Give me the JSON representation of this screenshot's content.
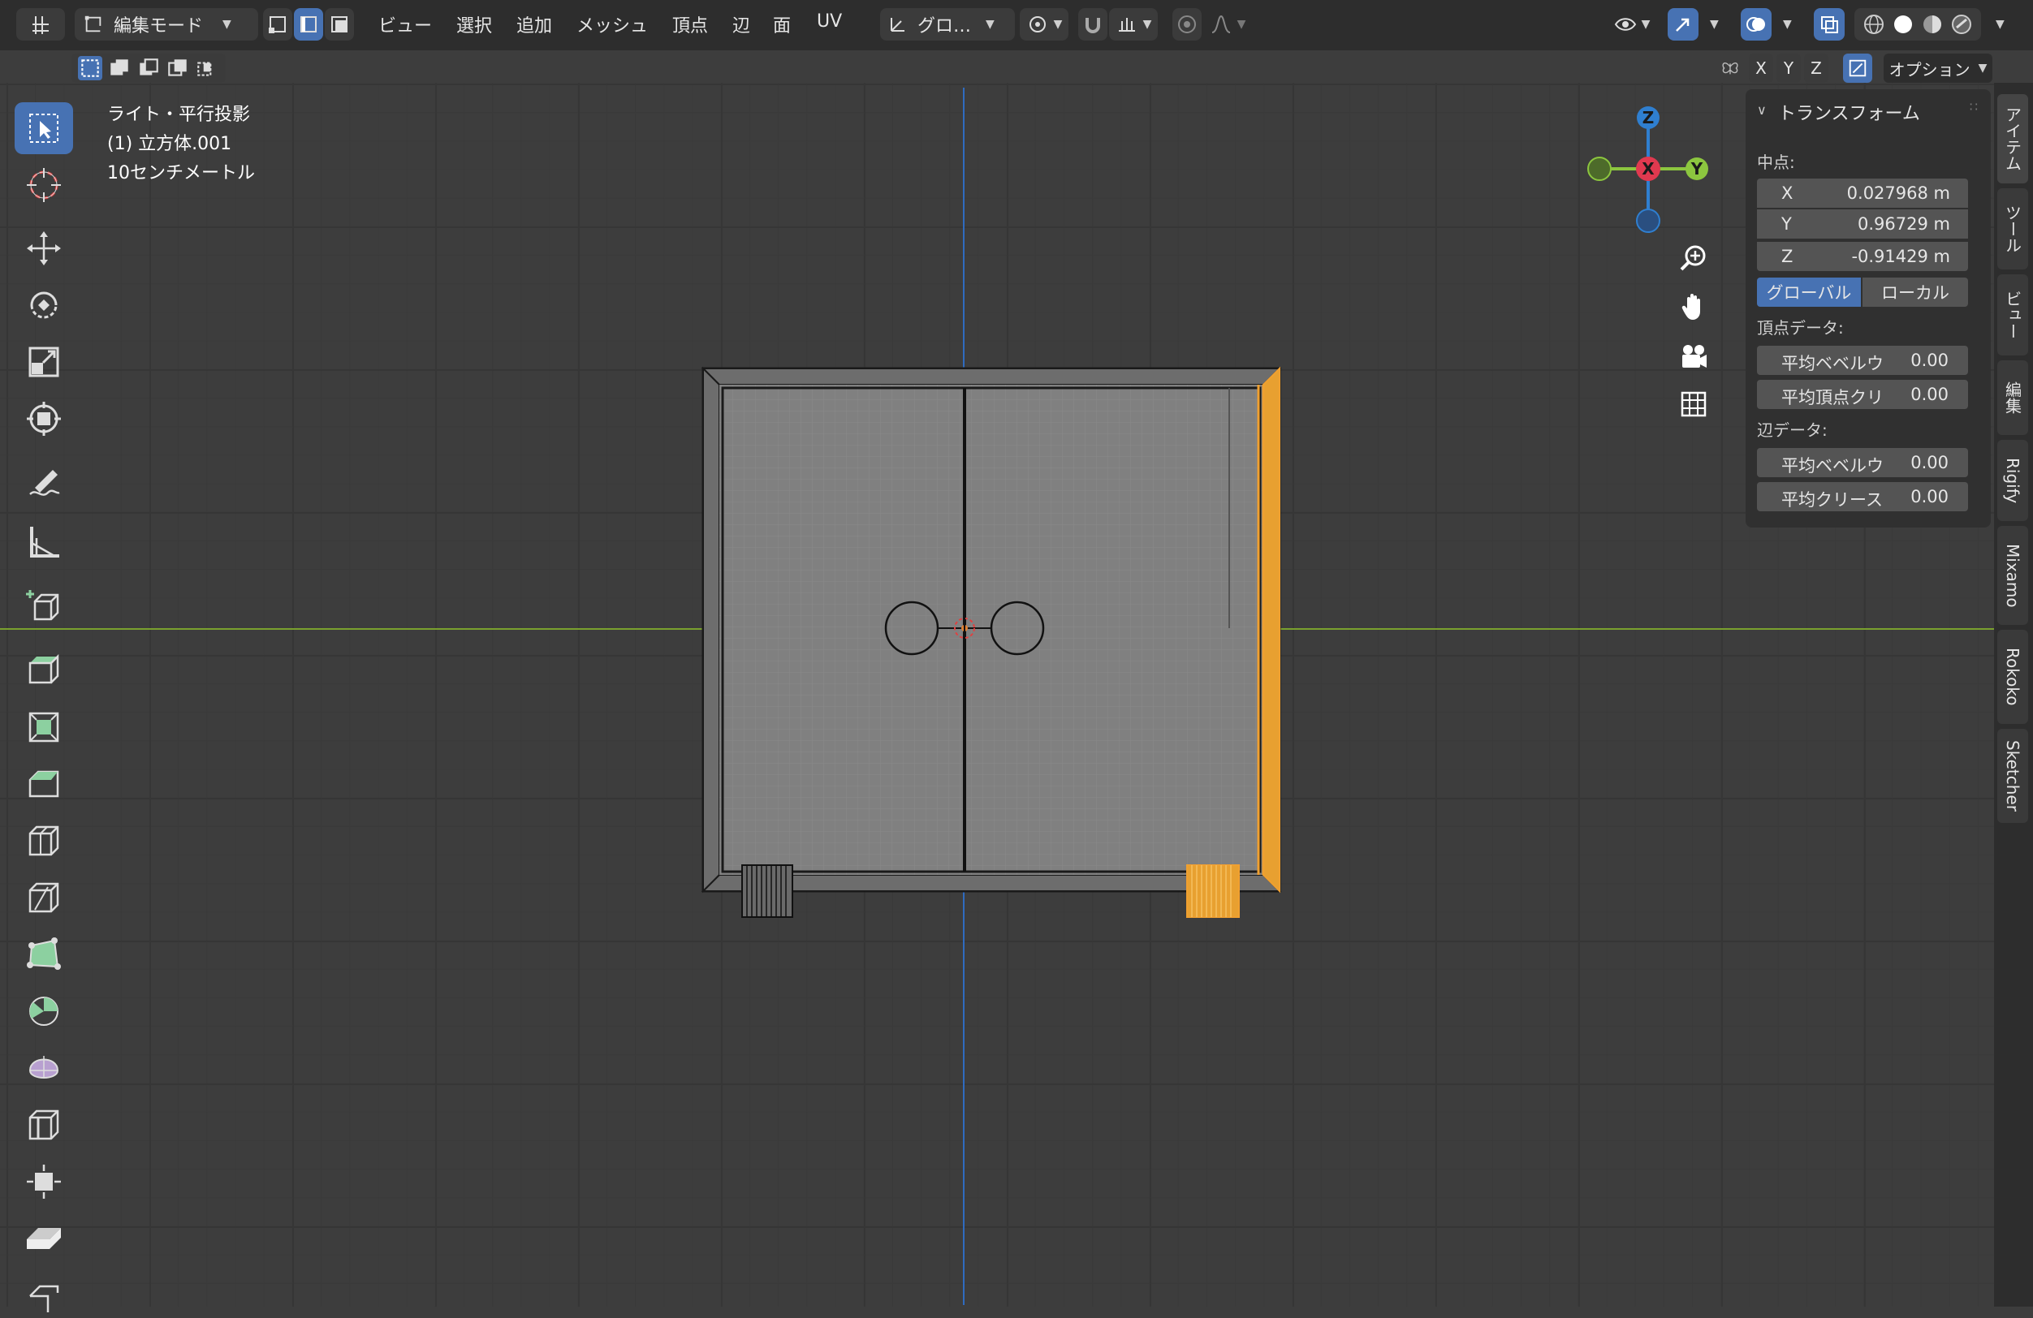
{
  "header": {
    "mode": "編集モード",
    "menus": [
      "ビュー",
      "選択",
      "追加",
      "メッシュ",
      "頂点",
      "辺",
      "面",
      "UV"
    ],
    "transform_orientation": "グロ…",
    "options_label": "オプション",
    "axes": [
      "X",
      "Y",
      "Z"
    ]
  },
  "viewport": {
    "info_lines": [
      "ライト・平行投影",
      "(1) 立方体.001",
      "10センチメートル"
    ]
  },
  "gizmo": {
    "x": "X",
    "y": "Y",
    "z": "Z"
  },
  "npanel": {
    "title": "トランスフォーム",
    "median_label": "中点:",
    "median": {
      "x_label": "X",
      "x": "0.027968 m",
      "y_label": "Y",
      "y": "0.96729 m",
      "z_label": "Z",
      "z": "-0.91429 m"
    },
    "global_label": "グローバル",
    "local_label": "ローカル",
    "vertex_data_label": "頂点データ:",
    "vertex_fields": [
      {
        "label": "平均ベベルウ",
        "value": "0.00"
      },
      {
        "label": "平均頂点クリ",
        "value": "0.00"
      }
    ],
    "edge_data_label": "辺データ:",
    "edge_fields": [
      {
        "label": "平均ベベルウ",
        "value": "0.00"
      },
      {
        "label": "平均クリース",
        "value": "0.00"
      }
    ]
  },
  "side_tabs": [
    "アイテム",
    "ツール",
    "ビュー",
    "編集",
    "Rigify",
    "Mixamo",
    "Rokoko",
    "Sketcher"
  ],
  "colors": {
    "accent": "#4772b3",
    "selection": "#f0a030",
    "axis_x": "#e0394f",
    "axis_y": "#8cc63f",
    "axis_z": "#2f7fd0"
  },
  "icons": {
    "toolbar": [
      "select-box-icon",
      "cursor-icon",
      "move-icon",
      "rotate-icon",
      "scale-icon",
      "transform-icon",
      "annotate-icon",
      "measure-icon",
      "add-cube-icon",
      "extrude-icon",
      "inset-icon",
      "bevel-icon",
      "loop-cut-icon",
      "knife-icon",
      "poly-build-icon",
      "spin-icon",
      "smooth-icon",
      "edge-slide-icon",
      "shrink-fatten-icon",
      "shear-icon",
      "rip-icon"
    ]
  }
}
